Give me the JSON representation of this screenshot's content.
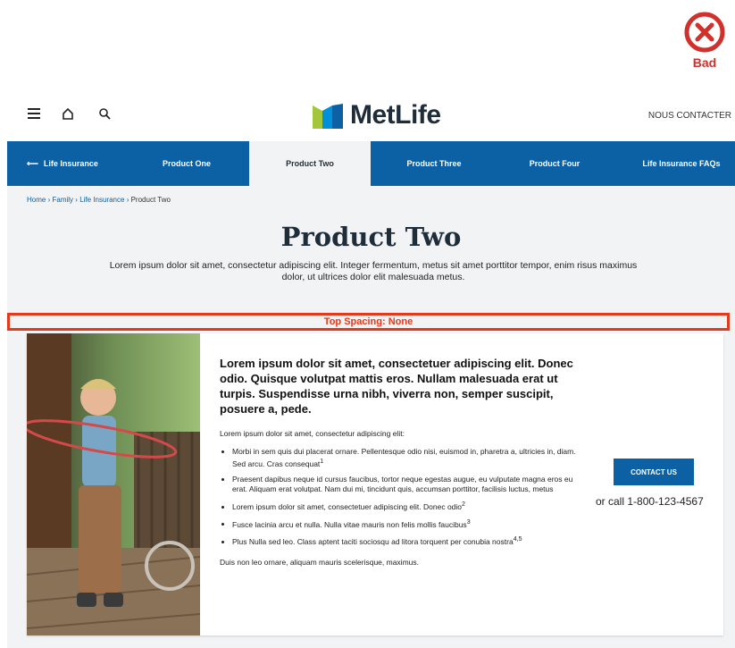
{
  "annotation": {
    "label": "Bad",
    "spacing_label": "Top Spacing: None",
    "color": "#d0312d"
  },
  "header": {
    "logo_text": "MetLife",
    "contact_label": "NOUS CONTACTER"
  },
  "nav": {
    "back_label": "Life Insurance",
    "items": [
      {
        "label": "Product One"
      },
      {
        "label": "Product Two",
        "active": true
      },
      {
        "label": "Product Three"
      },
      {
        "label": "Product Four"
      },
      {
        "label": "Life Insurance FAQs"
      }
    ],
    "bg_color": "#0b61a4"
  },
  "breadcrumb": {
    "items": [
      "Home",
      "Family",
      "Life Insurance"
    ],
    "separator": "›",
    "current": "Product Two"
  },
  "page": {
    "title": "Product Two",
    "subtitle": "Lorem ipsum dolor sit amet, consectetur adipiscing elit. Integer fermentum, metus sit amet porttitor tempor, enim risus maximus dolor, ut ultrices dolor elit malesuada metus."
  },
  "card": {
    "headline": "Lorem ipsum dolor sit amet, consectetuer adipiscing elit. Donec odio. Quisque volutpat mattis eros. Nullam malesuada erat ut turpis. Suspendisse urna nibh, viverra non, semper suscipit, posuere a, pede.",
    "lead": "Lorem ipsum dolor sit amet, consectetur adipiscing elit:",
    "bullets": [
      {
        "text": "Morbi in sem quis dui placerat ornare. Pellentesque odio nisi, euismod in, pharetra a, ultricies in, diam. Sed arcu. Cras consequat",
        "sup": "1"
      },
      {
        "text": "Praesent dapibus neque id cursus faucibus, tortor neque egestas augue, eu vulputate magna eros eu erat. Aliquam erat volutpat. Nam dui mi, tincidunt quis, accumsan porttitor, facilisis luctus, metus",
        "sup": ""
      },
      {
        "text": "Lorem ipsum dolor sit amet, consectetuer adipiscing elit. Donec odio",
        "sup": "2"
      },
      {
        "text": "Fusce lacinia arcu et nulla. Nulla vitae mauris non felis mollis faucibus",
        "sup": "3"
      },
      {
        "text": "Plus Nulla sed leo. Class aptent taciti sociosqu ad litora torquent per conubia nostra",
        "sup": "4,5"
      }
    ],
    "outro": "Duis non leo ornare, aliquam mauris scelerisque, maximus.",
    "cta_label": "CONTACT US",
    "call_text": "or call 1-800-123-4567"
  },
  "icons": [
    "close-circle-icon",
    "menu-icon",
    "home-icon",
    "search-icon",
    "metlife-logo-icon",
    "arrow-left-icon"
  ]
}
